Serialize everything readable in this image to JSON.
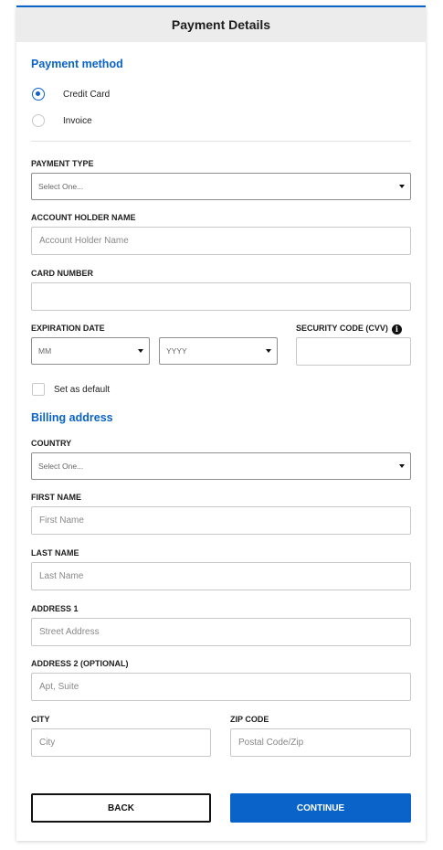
{
  "header": {
    "title": "Payment Details"
  },
  "payment_method": {
    "title": "Payment method",
    "options": [
      {
        "label": "Credit Card",
        "checked": true
      },
      {
        "label": "Invoice",
        "checked": false
      }
    ]
  },
  "payment_type": {
    "label": "PAYMENT TYPE",
    "value": "Select One..."
  },
  "account_holder": {
    "label": "ACCOUNT HOLDER NAME",
    "placeholder": "Account Holder Name"
  },
  "card_number": {
    "label": "CARD NUMBER",
    "placeholder": ""
  },
  "expiration": {
    "label": "EXPIRATION DATE",
    "month": "MM",
    "year": "YYYY"
  },
  "security_code": {
    "label": "SECURITY CODE (CVV)",
    "placeholder": "",
    "info_icon": "info-icon"
  },
  "set_default": {
    "label": "Set as default",
    "checked": false
  },
  "billing": {
    "title": "Billing address",
    "country": {
      "label": "COUNTRY",
      "value": "Select One..."
    },
    "first_name": {
      "label": "FIRST NAME",
      "placeholder": "First Name"
    },
    "last_name": {
      "label": "LAST NAME",
      "placeholder": "Last Name"
    },
    "address1": {
      "label": "ADDRESS 1",
      "placeholder": "Street Address"
    },
    "address2": {
      "label": "ADDRESS 2 (OPTIONAL)",
      "placeholder": "Apt, Suite"
    },
    "city": {
      "label": "CITY",
      "placeholder": "City"
    },
    "zip": {
      "label": "ZIP CODE",
      "placeholder": "Postal Code/Zip"
    }
  },
  "actions": {
    "back": "BACK",
    "continue": "CONTINUE"
  },
  "colors": {
    "accent": "#0a63c9",
    "header_bg": "#ececec",
    "border": "#c8c8c8"
  }
}
